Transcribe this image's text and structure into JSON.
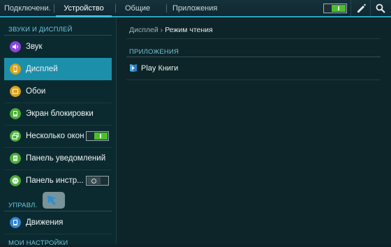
{
  "tabs": [
    {
      "label": "Подключени..."
    },
    {
      "label": "Устройство"
    },
    {
      "label": "Общие"
    },
    {
      "label": "Приложения"
    }
  ],
  "toolbar": {
    "toggle_state": "on",
    "edit_icon": "pencil-icon",
    "search_icon": "search-icon"
  },
  "sidebar": {
    "section1": "ЗВУКИ И ДИСПЛЕЙ",
    "items": [
      {
        "label": "Звук",
        "icon": "speaker-icon",
        "color": "#8e44d9"
      },
      {
        "label": "Дисплей",
        "icon": "phone-icon",
        "color": "#d9a21a"
      },
      {
        "label": "Обои",
        "icon": "wallpaper-icon",
        "color": "#d9a21a"
      },
      {
        "label": "Экран блокировки",
        "icon": "lock-screen-icon",
        "color": "#49b035"
      },
      {
        "label": "Несколько окон",
        "icon": "multi-window-icon",
        "color": "#49b035",
        "toggle": "on"
      },
      {
        "label": "Панель уведомлений",
        "icon": "notification-icon",
        "color": "#49b035"
      },
      {
        "label": "Панель инстр...",
        "icon": "toolbox-icon",
        "color": "#49b035",
        "toggle": "off"
      }
    ],
    "section2": "УПРАВЛ.",
    "items2": [
      {
        "label": "Движения",
        "icon": "motion-icon",
        "color": "#2f86d6"
      }
    ],
    "section3": "МОИ НАСТРОЙКИ"
  },
  "main": {
    "breadcrumb_parent": "Дисплей",
    "breadcrumb_separator": "›",
    "breadcrumb_current": "Режим чтения",
    "section": "ПРИЛОЖЕНИЯ",
    "apps": [
      {
        "label": "Play Книги",
        "icon": "play-books-icon"
      }
    ]
  },
  "colors": {
    "accent": "#1c8fab",
    "toggle_on": "#4bbf2a",
    "section_header": "#6fc4d8"
  }
}
